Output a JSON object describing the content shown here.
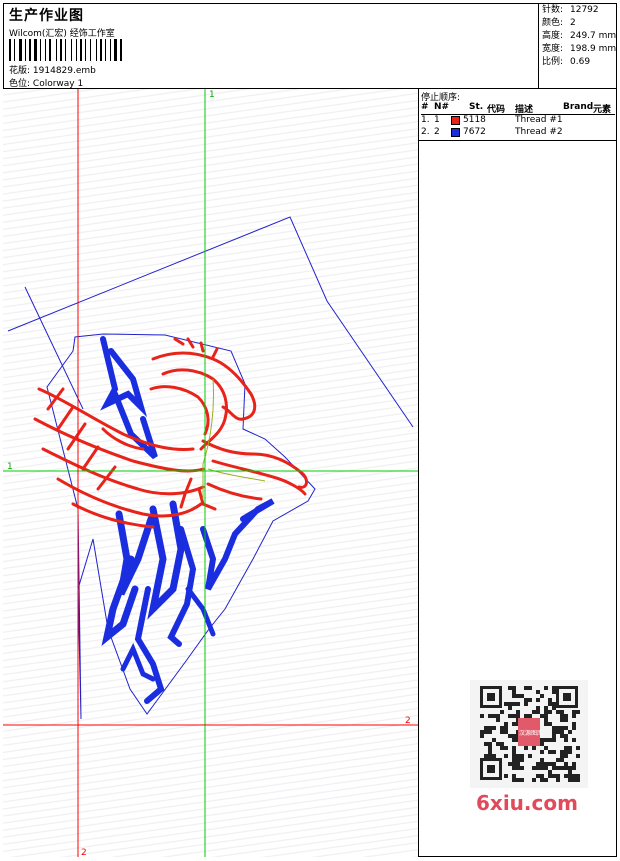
{
  "header": {
    "title": "生产作业图",
    "company": "Wilcom(汇宏) 经饰工作室",
    "design_label": "花版:",
    "design_value": "1914829.emb",
    "colorway_label": "色位:",
    "colorway_value": "Colorway 1"
  },
  "specs": [
    {
      "label": "针数:",
      "value": "12792"
    },
    {
      "label": "颜色:",
      "value": "2"
    },
    {
      "label": "高度:",
      "value": "249.7 mm"
    },
    {
      "label": "宽度:",
      "value": "198.9 mm"
    },
    {
      "label": "比例:",
      "value": "0.69"
    }
  ],
  "thread_panel": {
    "title": "停止顺序:",
    "columns": [
      "#",
      "N#",
      "St.",
      "代码",
      "描述",
      "Brand",
      "元素"
    ],
    "rows": [
      {
        "num": "1.",
        "n": "1",
        "color": "#e8231a",
        "code": "5118",
        "desc": "Thread #1"
      },
      {
        "num": "2.",
        "n": "2",
        "color": "#1a2ee0",
        "code": "7672",
        "desc": "Thread #2"
      }
    ]
  },
  "guides": {
    "green_label_top": "1",
    "green_label_left": "1",
    "red_label_right": "2",
    "red_label_bottom": "2"
  },
  "colors": {
    "red": "#ff0000",
    "blue": "#0000ff",
    "green": "#00cc00",
    "outline": "#2222cc"
  },
  "watermark": {
    "seal": "汉源图库",
    "site": "6xiu.com"
  }
}
